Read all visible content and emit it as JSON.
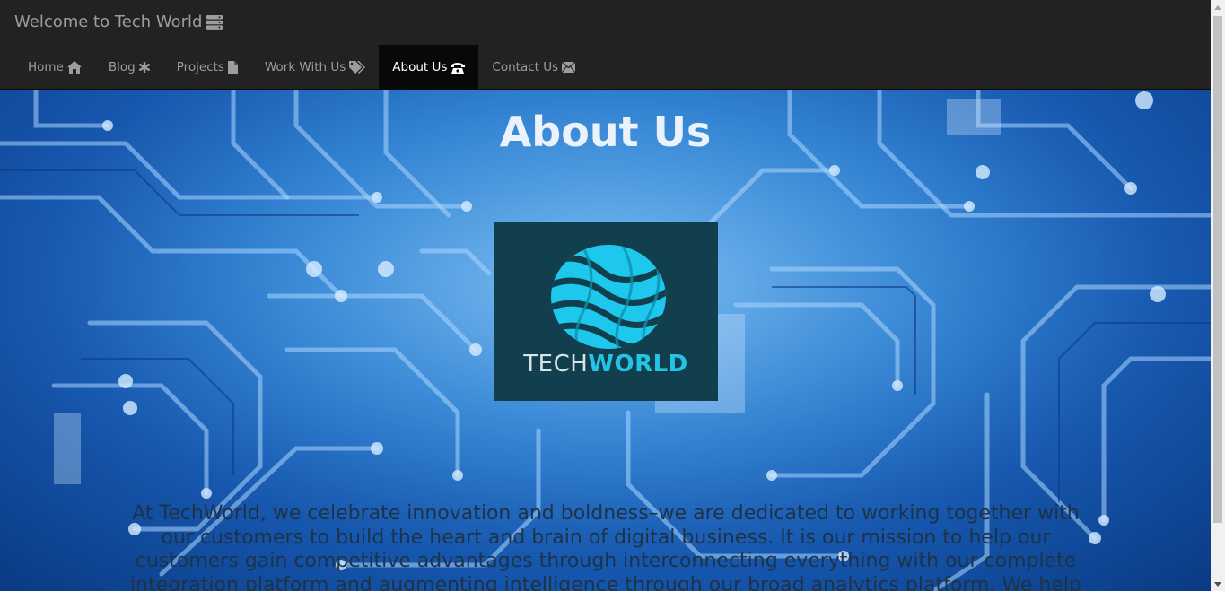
{
  "navbar": {
    "brand": "Welcome to Tech World",
    "brand_icon": "server-icon",
    "items": [
      {
        "label": "Home",
        "icon": "home-icon",
        "active": false
      },
      {
        "label": "Blog",
        "icon": "asterisk-icon",
        "active": false
      },
      {
        "label": "Projects",
        "icon": "file-icon",
        "active": false
      },
      {
        "label": "Work With Us",
        "icon": "tags-icon",
        "active": false
      },
      {
        "label": "About Us",
        "icon": "phone-icon",
        "active": true
      },
      {
        "label": "Contact Us",
        "icon": "envelope-icon",
        "active": false
      }
    ]
  },
  "main": {
    "title": "About Us",
    "logo": {
      "word_light": "TECH",
      "word_bold": "WORLD"
    },
    "text": "At TechWorld, we celebrate innovation and boldness–we are dedicated to working together with our customers to build the heart and brain of digital business. It is our mission to help our customers gain competitive advantages through interconnecting everything with our complete integration platform and augmenting intelligence through our broad analytics platform. We help"
  },
  "colors": {
    "navbar_bg": "#222222",
    "nav_active_bg": "#080808",
    "nav_text": "#9d9d9d",
    "logo_bg": "#123f4d",
    "logo_accent": "#23c4e6"
  }
}
